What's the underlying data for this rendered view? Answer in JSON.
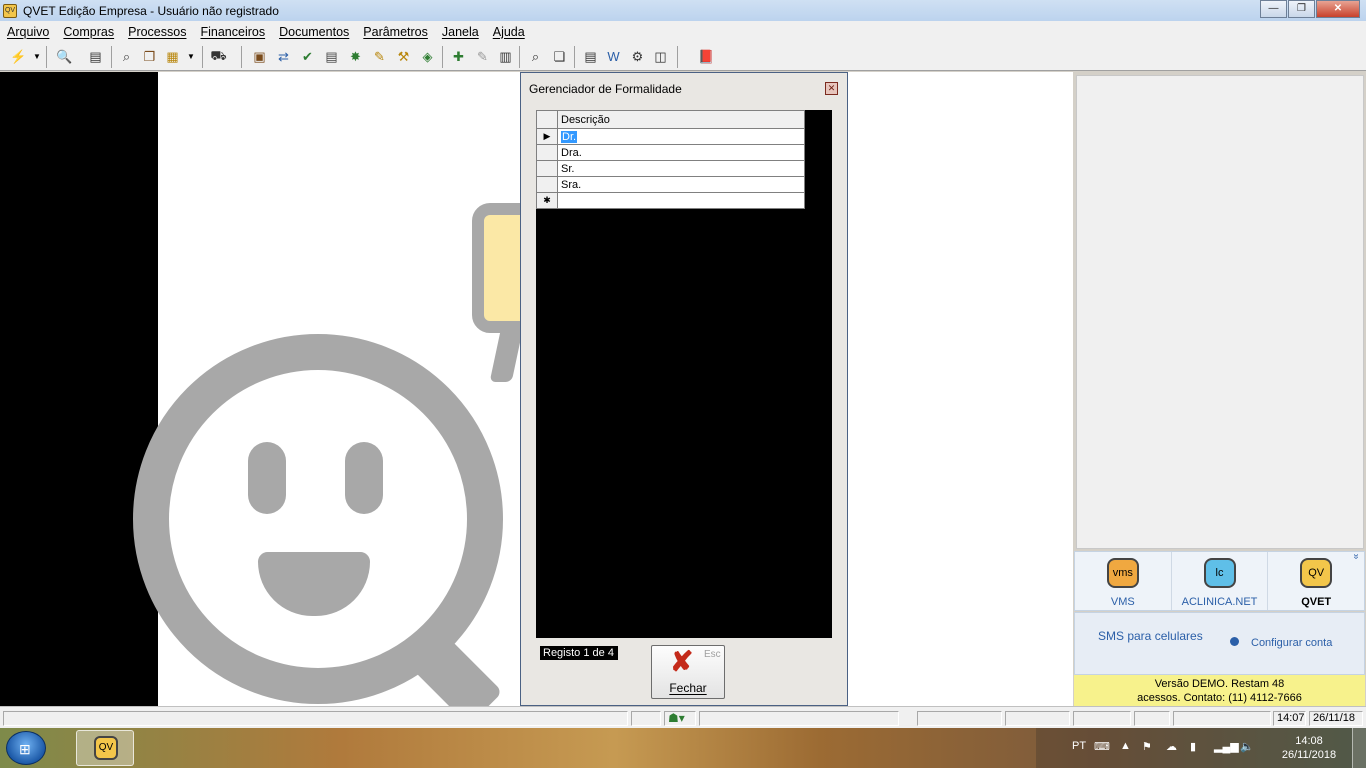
{
  "window": {
    "app_icon": "QV",
    "title": "QVET Edição Empresa - Usuário não registrado",
    "min_icon": "minimize-icon",
    "max_icon": "maximize-icon",
    "close_icon": "close-icon",
    "min_glyph": "—",
    "max_glyph": "❐",
    "close_glyph": "✕"
  },
  "menu": [
    "Arquivo",
    "Compras",
    "Processos",
    "Financeiros",
    "Documentos",
    "Parâmetros",
    "Janela",
    "Ajuda"
  ],
  "dialog": {
    "title": "Gerenciador de Formalidade",
    "close_glyph": "✕",
    "grid": {
      "header": "Descrição",
      "current_indicator": "▶",
      "new_indicator": "✱",
      "rows": [
        "Dr.",
        "Dra.",
        "Sr.",
        "Sra."
      ]
    },
    "record_status": "Registo 1 de 4",
    "close_button": {
      "label": "Fechar",
      "shortcut": "Esc",
      "glyph": "✘"
    }
  },
  "right_panel": {
    "apps": [
      {
        "icon": "vms",
        "label": "VMS",
        "color": "#f0a840"
      },
      {
        "icon": "lc",
        "label": "ACLINICA.NET",
        "color": "#5fbfe8"
      },
      {
        "icon": "QV",
        "label": "QVET",
        "color": "#f3c64a"
      }
    ],
    "expand_glyph": "»",
    "sms_label": "SMS para celulares",
    "config_label": "Configurar conta",
    "demo_line1": "Versão DEMO. Restam 48",
    "demo_line2": "acessos. Contato: (11) 4112-7666"
  },
  "status_bar": {
    "time": "14:07",
    "date": "26/11/18"
  },
  "taskbar": {
    "start_glyph": "⊞",
    "app_icon": "QV",
    "language": "PT",
    "clock_time": "14:08",
    "clock_date": "26/11/2018"
  }
}
